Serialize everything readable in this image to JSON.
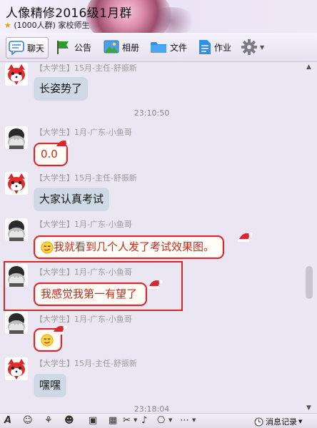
{
  "header": {
    "title": "人像精修2016级1月群",
    "member_count": "(1000人群)",
    "category": "家校师生"
  },
  "toolbar": {
    "items": [
      {
        "label": "聊天",
        "icon": "chat-bubble-icon",
        "active": true
      },
      {
        "label": "公告",
        "icon": "flag-icon"
      },
      {
        "label": "相册",
        "icon": "photo-album-icon"
      },
      {
        "label": "文件",
        "icon": "folder-icon"
      },
      {
        "label": "作业",
        "icon": "document-icon"
      }
    ],
    "settings_icon": "gear-icon"
  },
  "messages": [
    {
      "tag": "【大学生】",
      "sender": "15月-主任-舒振新",
      "text": "长姿势了",
      "avatar": "red-fox-avatar",
      "style": "plain"
    },
    {
      "timestamp": "23:10:50"
    },
    {
      "tag": "【大学生】",
      "sender": "1月-广东-小鱼哥",
      "text": "0.0",
      "avatar": "covered-face-avatar",
      "style": "red-frame"
    },
    {
      "tag": "【大学生】",
      "sender": "15月-主任-舒振新",
      "text": "大家认真考试",
      "avatar": "red-fox-avatar",
      "style": "plain"
    },
    {
      "tag": "【大学生】",
      "sender": "1月-广东-小鱼哥",
      "text": "我就看到几个人发了考试效果图。",
      "avatar": "covered-face-avatar",
      "style": "red-frame",
      "emoji": "smirk-smiley-icon"
    },
    {
      "tag": "【大学生】",
      "sender": "1月-广东-小鱼哥",
      "text": "我感觉我第一有望了",
      "avatar": "covered-face-avatar",
      "style": "red-frame",
      "highlighted": true
    },
    {
      "tag": "【大学生】",
      "sender": "1月-广东-小鱼哥",
      "text": "",
      "avatar": "covered-face-avatar",
      "style": "red-frame",
      "emoji": "smirk-smiley-icon"
    },
    {
      "tag": "【大学生】",
      "sender": "15月-主任-舒振新",
      "text": "嘿嘿",
      "avatar": "red-fox-avatar",
      "style": "plain"
    },
    {
      "timestamp": "23:18:04"
    }
  ],
  "bottombar": {
    "icons": [
      "font-icon",
      "emoji-icon",
      "magic-wand-icon",
      "cat-face-icon",
      "image-icon",
      "grid-icon",
      "scissors-icon",
      "music-note-icon",
      "screenshot-icon",
      "more-icon"
    ],
    "history_label": "消息记录"
  },
  "colors": {
    "highlight_box": "#d7262b",
    "bubble_plain": "#cfd9e6",
    "bubble_frame": "#d8272d",
    "frame_text": "#c7291f"
  }
}
